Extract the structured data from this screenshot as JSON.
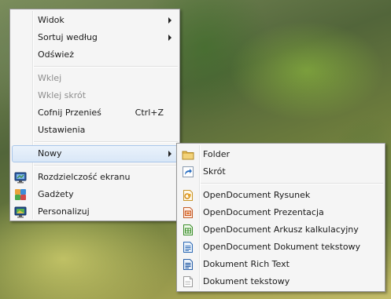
{
  "context_menu": {
    "items": [
      {
        "label": "Widok"
      },
      {
        "label": "Sortuj według"
      },
      {
        "label": "Odśwież"
      },
      {
        "label": "Wklej"
      },
      {
        "label": "Wklej skrót"
      },
      {
        "label": "Cofnij Przenieś",
        "shortcut": "Ctrl+Z"
      },
      {
        "label": "Ustawienia"
      },
      {
        "label": "Nowy"
      },
      {
        "label": "Rozdzielczość ekranu",
        "icon": "screen-resolution-icon"
      },
      {
        "label": "Gadżety",
        "icon": "gadgets-icon"
      },
      {
        "label": "Personalizuj",
        "icon": "personalize-icon"
      }
    ]
  },
  "new_submenu": {
    "items": [
      {
        "label": "Folder",
        "icon": "folder-icon"
      },
      {
        "label": "Skrót",
        "icon": "shortcut-icon"
      },
      {
        "label": "OpenDocument Rysunek",
        "icon": "odf-drawing-icon"
      },
      {
        "label": "OpenDocument Prezentacja",
        "icon": "odf-presentation-icon"
      },
      {
        "label": "OpenDocument Arkusz kalkulacyjny",
        "icon": "odf-spreadsheet-icon"
      },
      {
        "label": "OpenDocument Dokument tekstowy",
        "icon": "odf-text-icon"
      },
      {
        "label": "Dokument Rich Text",
        "icon": "rich-text-icon"
      },
      {
        "label": "Dokument tekstowy",
        "icon": "text-document-icon"
      }
    ]
  },
  "colors": {
    "menu_bg": "#f5f5f5",
    "highlight": "#d9e7f7",
    "disabled_text": "#8d8d8d"
  }
}
